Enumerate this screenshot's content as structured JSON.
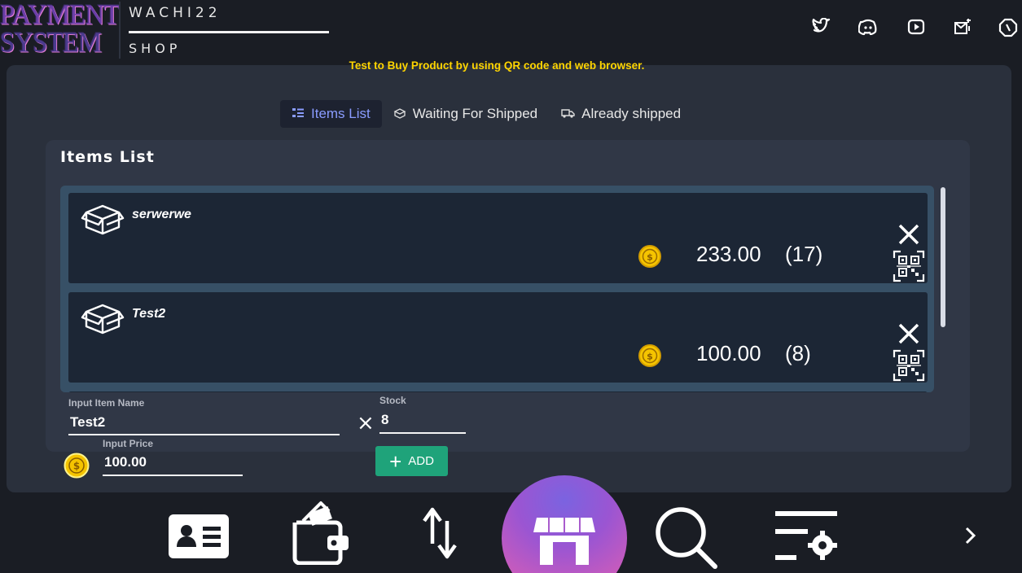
{
  "header": {
    "logo_line1": "PAYMENT",
    "logo_line2": "SYSTEM",
    "brand_name": "WACHI22",
    "brand_sub": "SHOP",
    "social_icons": [
      "twitter-icon",
      "discord-icon",
      "youtube-icon",
      "mail-icon",
      "settings-icon"
    ]
  },
  "notice": "Test to Buy Product by using QR code and web browser.",
  "tabs": [
    {
      "label": "Items List",
      "icon": "list-icon",
      "active": true
    },
    {
      "label": "Waiting For Shipped",
      "icon": "box-outline-icon",
      "active": false
    },
    {
      "label": "Already shipped",
      "icon": "truck-icon",
      "active": false
    }
  ],
  "list": {
    "title": "Items List",
    "items": [
      {
        "name": "serwerwe",
        "price": "233.00",
        "qty": "(17)"
      },
      {
        "name": "Test2",
        "price": "100.00",
        "qty": "(8)"
      }
    ]
  },
  "form": {
    "name_label": "Input Item Name",
    "name_value": "Test2",
    "stock_label": "Stock",
    "stock_value": "8",
    "price_label": "Input Price",
    "price_value": "100.00",
    "times_symbol": "×",
    "add_label": "ADD"
  },
  "bottom_nav": {
    "items": [
      "contact-card-icon",
      "wallet-icon",
      "transfer-icon",
      "store-icon",
      "search-icon",
      "settings-list-icon"
    ],
    "next_icon": "chevron-right-icon"
  },
  "colors": {
    "accent_yellow": "#ffd500",
    "coin": "#f5c400",
    "add_green": "#1fa37a",
    "active_tab_text": "#8a9cff"
  }
}
